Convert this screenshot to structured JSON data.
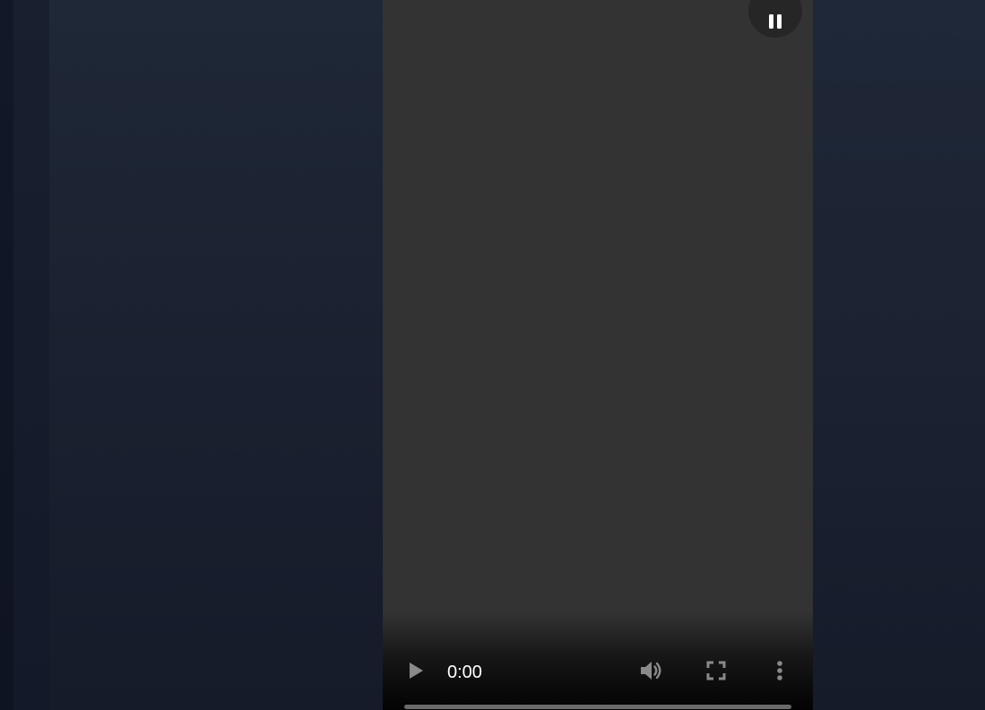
{
  "video_player": {
    "time_display": "0:00",
    "progress": 0,
    "state": "paused",
    "controls": {
      "play": "play-icon",
      "volume": "volume-icon",
      "fullscreen": "fullscreen-icon",
      "more": "more-options-icon"
    },
    "overlay_button": "pause-icon"
  },
  "colors": {
    "video_background": "#333333",
    "page_background": "#1b2232",
    "control_icon": "#8a8a8a",
    "time_text": "#ffffff",
    "timeline_track": "#6a6a6a",
    "overlay_button_bg": "#262626"
  }
}
